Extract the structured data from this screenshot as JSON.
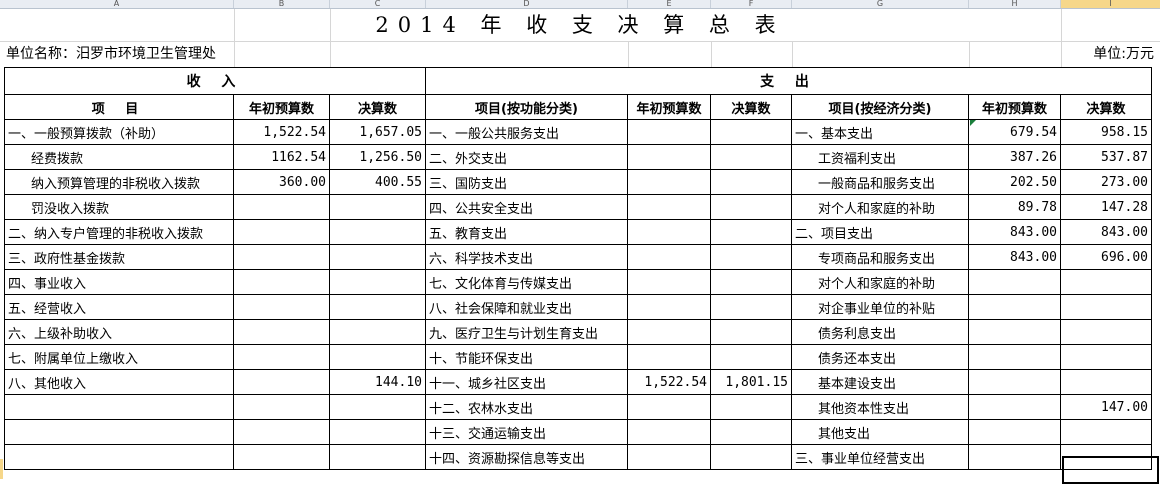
{
  "column_headers": [
    "A",
    "B",
    "C",
    "D",
    "E",
    "F",
    "G",
    "H",
    "I"
  ],
  "title": "2014 年 收 支 决 算 总 表",
  "unit_name": "单位名称：汨罗市环境卫生管理处",
  "unit": "单位:万元",
  "section_income": "收 入",
  "section_expense": "支 出",
  "headers": {
    "item": "项 目",
    "budget": "年初预算数",
    "final": "决算数",
    "func_item": "项目(按功能分类)",
    "econ_item": "项目(按经济分类)"
  },
  "rows": [
    {
      "inc": "一、一般预算拨款（补助）",
      "inc_b": "1,522.54",
      "inc_f": "1,657.05",
      "fun": "一、一般公共服务支出",
      "fun_b": "",
      "fun_f": "",
      "eco": "一、基本支出",
      "eco_b": "679.54",
      "eco_f": "958.15"
    },
    {
      "inc": "经费拨款",
      "inc_b": "1162.54",
      "inc_f": "1,256.50",
      "fun": "二、外交支出",
      "fun_b": "",
      "fun_f": "",
      "eco": "工资福利支出",
      "eco_b": "387.26",
      "eco_f": "537.87"
    },
    {
      "inc": "纳入预算管理的非税收入拨款",
      "inc_b": "360.00",
      "inc_f": "400.55",
      "fun": "三、国防支出",
      "fun_b": "",
      "fun_f": "",
      "eco": "一般商品和服务支出",
      "eco_b": "202.50",
      "eco_f": "273.00"
    },
    {
      "inc": "罚没收入拨款",
      "inc_b": "",
      "inc_f": "",
      "fun": "四、公共安全支出",
      "fun_b": "",
      "fun_f": "",
      "eco": "对个人和家庭的补助",
      "eco_b": "89.78",
      "eco_f": "147.28"
    },
    {
      "inc": "二、纳入专户管理的非税收入拨款",
      "inc_b": "",
      "inc_f": "",
      "fun": "五、教育支出",
      "fun_b": "",
      "fun_f": "",
      "eco": "二、项目支出",
      "eco_b": "843.00",
      "eco_f": "843.00"
    },
    {
      "inc": "三、政府性基金拨款",
      "inc_b": "",
      "inc_f": "",
      "fun": "六、科学技术支出",
      "fun_b": "",
      "fun_f": "",
      "eco": "专项商品和服务支出",
      "eco_b": "843.00",
      "eco_f": "696.00"
    },
    {
      "inc": "四、事业收入",
      "inc_b": "",
      "inc_f": "",
      "fun": "七、文化体育与传媒支出",
      "fun_b": "",
      "fun_f": "",
      "eco": "对个人和家庭的补助",
      "eco_b": "",
      "eco_f": ""
    },
    {
      "inc": "五、经营收入",
      "inc_b": "",
      "inc_f": "",
      "fun": "八、社会保障和就业支出",
      "fun_b": "",
      "fun_f": "",
      "eco": "对企事业单位的补贴",
      "eco_b": "",
      "eco_f": ""
    },
    {
      "inc": "六、上级补助收入",
      "inc_b": "",
      "inc_f": "",
      "fun": "九、医疗卫生与计划生育支出",
      "fun_b": "",
      "fun_f": "",
      "eco": "债务利息支出",
      "eco_b": "",
      "eco_f": ""
    },
    {
      "inc": "七、附属单位上缴收入",
      "inc_b": "",
      "inc_f": "",
      "fun": "十、节能环保支出",
      "fun_b": "",
      "fun_f": "",
      "eco": "债务还本支出",
      "eco_b": "",
      "eco_f": ""
    },
    {
      "inc": "八、其他收入",
      "inc_b": "",
      "inc_f": "144.10",
      "fun": "十一、城乡社区支出",
      "fun_b": "1,522.54",
      "fun_f": "1,801.15",
      "eco": "基本建设支出",
      "eco_b": "",
      "eco_f": ""
    },
    {
      "inc": "",
      "inc_b": "",
      "inc_f": "",
      "fun": "十二、农林水支出",
      "fun_b": "",
      "fun_f": "",
      "eco": "其他资本性支出",
      "eco_b": "",
      "eco_f": "147.00"
    },
    {
      "inc": "",
      "inc_b": "",
      "inc_f": "",
      "fun": "十三、交通运输支出",
      "fun_b": "",
      "fun_f": "",
      "eco": "其他支出",
      "eco_b": "",
      "eco_f": ""
    },
    {
      "inc": "",
      "inc_b": "",
      "inc_f": "",
      "fun": "十四、资源勘探信息等支出",
      "fun_b": "",
      "fun_f": "",
      "eco": "三、事业单位经营支出",
      "eco_b": "",
      "eco_f": ""
    }
  ]
}
